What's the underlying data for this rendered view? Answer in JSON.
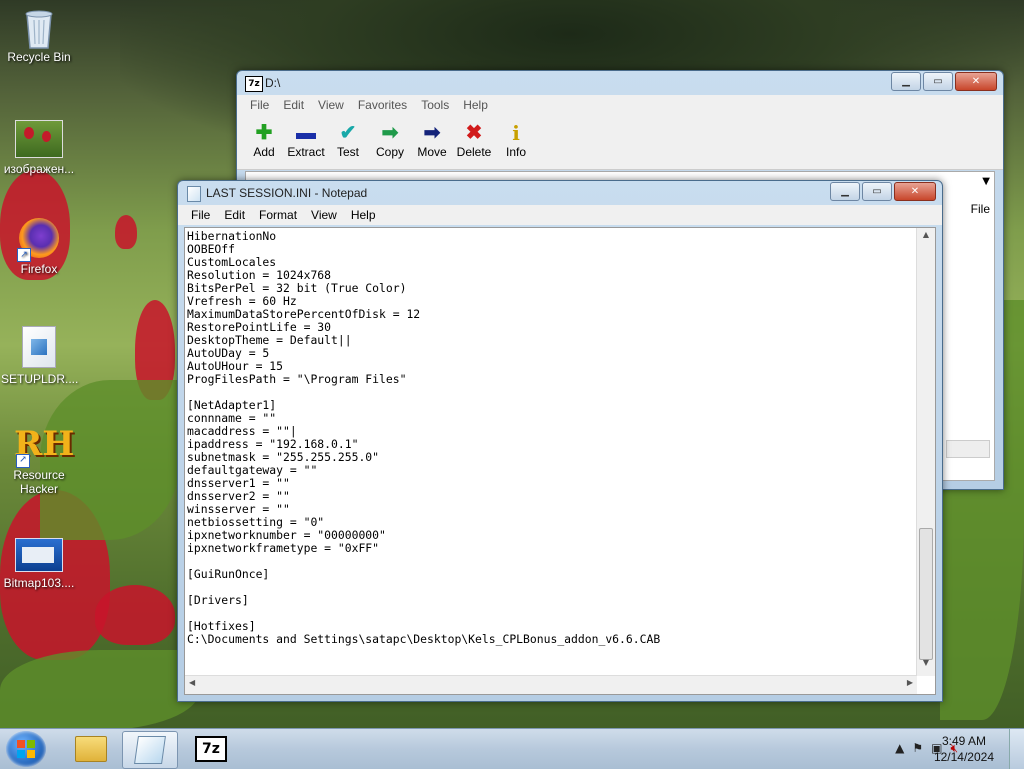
{
  "desktop": {
    "icons": [
      {
        "label": "Recycle Bin",
        "icon": "recycle-bin-icon"
      },
      {
        "label": "изображен...",
        "icon": "image-file-icon"
      },
      {
        "label": "Firefox",
        "icon": "firefox-icon"
      },
      {
        "label": "SETUPLDR....",
        "icon": "system-file-icon"
      },
      {
        "label": "Resource Hacker",
        "icon": "resource-hacker-icon"
      },
      {
        "label": "Bitmap103....",
        "icon": "bitmap-file-icon"
      }
    ]
  },
  "sevenzip": {
    "title": "D:\\",
    "app_icon": "7z",
    "menu": [
      "File",
      "Edit",
      "View",
      "Favorites",
      "Tools",
      "Help"
    ],
    "toolbar": [
      {
        "label": "Add",
        "icon": "plus-icon",
        "glyph": "✚",
        "color": "#22a022"
      },
      {
        "label": "Extract",
        "icon": "minus-icon",
        "glyph": "▬",
        "color": "#1a2fa8"
      },
      {
        "label": "Test",
        "icon": "check-icon",
        "glyph": "✔",
        "color": "#18a8a8"
      },
      {
        "label": "Copy",
        "icon": "copy-arrow-icon",
        "glyph": "➡",
        "color": "#1f9a4a"
      },
      {
        "label": "Move",
        "icon": "move-arrow-icon",
        "glyph": "➡",
        "color": "#14237a"
      },
      {
        "label": "Delete",
        "icon": "delete-x-icon",
        "glyph": "✖",
        "color": "#d11a1a"
      },
      {
        "label": "Info",
        "icon": "info-icon",
        "glyph": "i",
        "color": "#c8a000"
      }
    ],
    "column_file": "File"
  },
  "notepad": {
    "title": "LAST SESSION.INI - Notepad",
    "menu": [
      "File",
      "Edit",
      "Format",
      "View",
      "Help"
    ],
    "lines": [
      "HibernationNo",
      "OOBEOff",
      "CustomLocales",
      "Resolution = 1024x768",
      "BitsPerPel = 32 bit (True Color)",
      "Vrefresh = 60 Hz",
      "MaximumDataStorePercentOfDisk = 12",
      "RestorePointLife = 30",
      "DesktopTheme = Default||",
      "AutoUDay = 5",
      "AutoUHour = 15",
      "ProgFilesPath = \"\\Program Files\"",
      "",
      "[NetAdapter1]",
      "connname = \"\"",
      "macaddress = \"\"|",
      "ipaddress = \"192.168.0.1\"",
      "subnetmask = \"255.255.255.0\"",
      "defaultgateway = \"\"",
      "dnsserver1 = \"\"",
      "dnsserver2 = \"\"",
      "winsserver = \"\"",
      "netbiossetting = \"0\"",
      "ipxnetworknumber = \"00000000\"",
      "ipxnetworkframetype = \"0xFF\"",
      "",
      "[GuiRunOnce]",
      "",
      "[Drivers]",
      "",
      "[Hotfixes]",
      "C:\\Documents and Settings\\satapc\\Desktop\\Kels_CPLBonus_addon_v6.6.CAB"
    ]
  },
  "taskbar": {
    "apps": [
      {
        "name": "explorer",
        "icon": "folder-icon"
      },
      {
        "name": "notepad",
        "icon": "notepad-icon",
        "active": true
      },
      {
        "name": "7-zip",
        "icon": "7z-icon",
        "label": "7z"
      }
    ],
    "time": "3:49 AM",
    "date": "12/14/2024"
  }
}
